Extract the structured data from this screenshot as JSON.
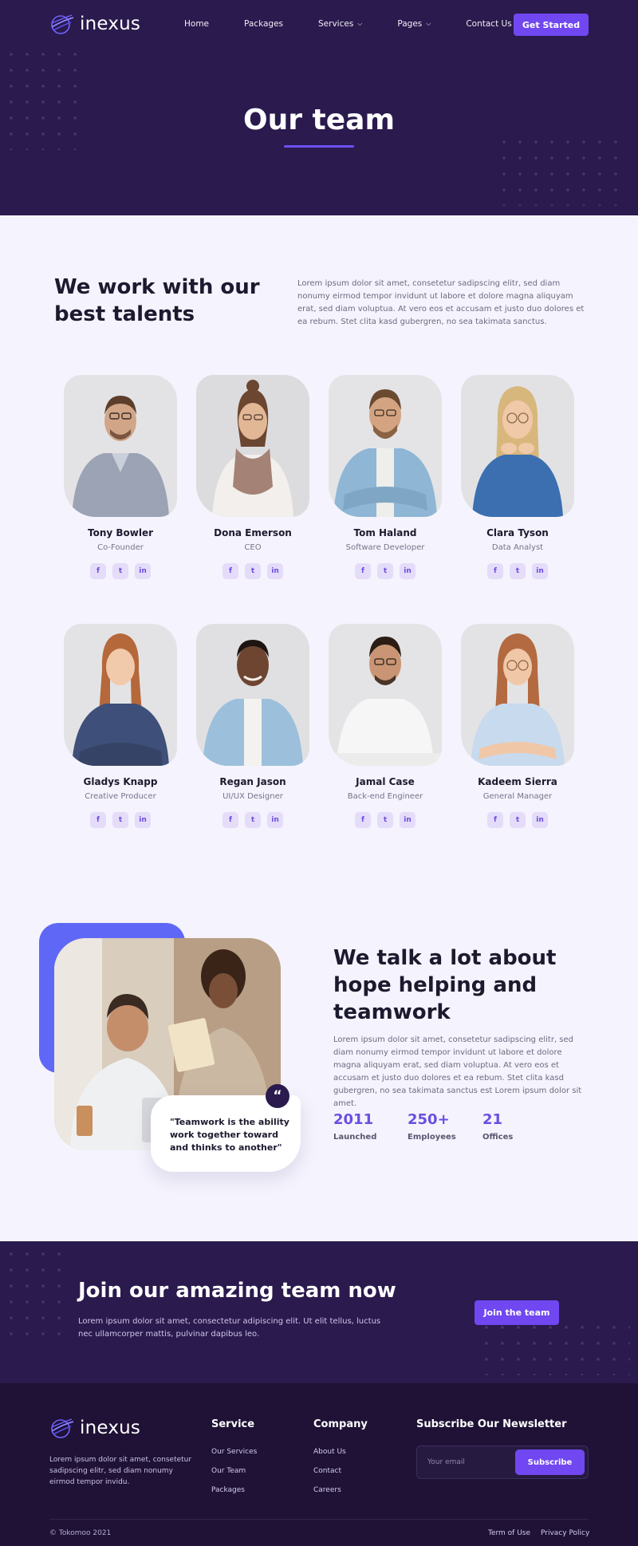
{
  "colors": {
    "brand_purple": "#7047f0",
    "dark_bg": "#2a1a4d",
    "footer_bg": "#1f1236",
    "page_bg": "#f5f3fd",
    "accent_blue": "#5f68f6"
  },
  "header": {
    "logo_text": "inexus",
    "nav": [
      {
        "label": "Home"
      },
      {
        "label": "Packages"
      },
      {
        "label": "Services",
        "dropdown": true
      },
      {
        "label": "Pages",
        "dropdown": true
      },
      {
        "label": "Contact Us"
      }
    ],
    "cta": "Get Started"
  },
  "hero": {
    "title": "Our team"
  },
  "intro": {
    "title": "We work with our best talents",
    "text": "Lorem ipsum dolor sit amet, consetetur sadipscing elitr, sed diam nonumy eirmod tempor invidunt ut labore et dolore magna aliquyam erat, sed diam voluptua. At vero eos et accusam et justo duo dolores et ea rebum. Stet clita kasd gubergren, no sea takimata sanctus."
  },
  "team": [
    {
      "name": "Tony Bowler",
      "role": "Co-Founder"
    },
    {
      "name": "Dona Emerson",
      "role": "CEO"
    },
    {
      "name": "Tom Haland",
      "role": "Software Developer"
    },
    {
      "name": "Clara Tyson",
      "role": "Data Analyst"
    },
    {
      "name": "Gladys Knapp",
      "role": "Creative Producer"
    },
    {
      "name": "Regan Jason",
      "role": "UI/UX Designer"
    },
    {
      "name": "Jamal Case",
      "role": "Back-end Engineer"
    },
    {
      "name": "Kadeem Sierra",
      "role": "General Manager"
    }
  ],
  "social_icons": [
    "facebook-icon",
    "twitter-icon",
    "linkedin-icon"
  ],
  "teamwork": {
    "title": "We talk a lot about hope helping and teamwork",
    "text": "Lorem ipsum dolor sit amet, consetetur sadipscing elitr, sed diam nonumy eirmod tempor invidunt ut labore et dolore magna aliquyam erat, sed diam voluptua. At vero eos et accusam et justo duo dolores et ea rebum. Stet clita kasd gubergren, no sea takimata sanctus est Lorem ipsum dolor sit amet.",
    "quote": "\"Teamwork is the ability work together toward and thinks to another\"",
    "stats": [
      {
        "value": "2011",
        "label": "Launched"
      },
      {
        "value": "250+",
        "label": "Employees"
      },
      {
        "value": "21",
        "label": "Offices"
      }
    ]
  },
  "join": {
    "title": "Join our amazing team now",
    "text": "Lorem ipsum dolor sit amet, consectetur adipiscing elit. Ut elit tellus, luctus nec ullamcorper mattis, pulvinar dapibus leo.",
    "button": "Join the team"
  },
  "footer": {
    "logo_text": "inexus",
    "about": "Lorem ipsum dolor sit amet, consetetur sadipscing elitr, sed diam nonumy eirmod tempor invidu.",
    "service": {
      "title": "Service",
      "links": [
        "Our Services",
        "Our Team",
        "Packages"
      ]
    },
    "company": {
      "title": "Company",
      "links": [
        "About Us",
        "Contact",
        "Careers"
      ]
    },
    "newsletter": {
      "title": "Subscribe Our Newsletter",
      "placeholder": "Your email",
      "button": "Subscribe"
    },
    "copyright": "© Tokomoo 2021",
    "legal": [
      "Term of Use",
      "Privacy Policy"
    ]
  }
}
